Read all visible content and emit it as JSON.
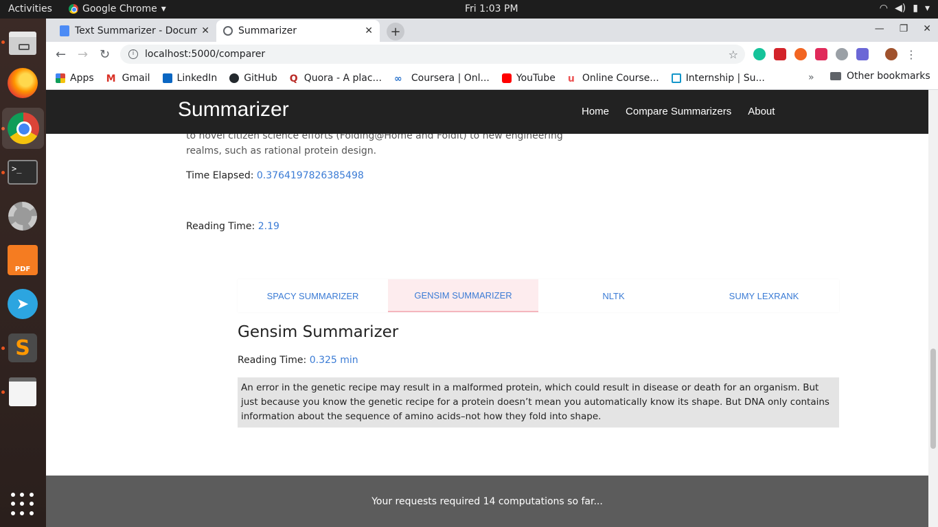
{
  "system": {
    "activities": "Activities",
    "app_name": "Google Chrome",
    "clock": "Fri  1:03 PM"
  },
  "dock": {
    "items": [
      "Files",
      "Firefox",
      "Chrome",
      "Terminal",
      "Settings",
      "PDF Editor",
      "Telegram",
      "Sublime Text",
      "Text Editor",
      "Show Applications"
    ]
  },
  "browser": {
    "tabs": [
      {
        "title": "Text Summarizer - Docum",
        "active": false
      },
      {
        "title": "Summarizer",
        "active": true
      }
    ],
    "url": "localhost:5000/comparer",
    "bookmarks": [
      "Apps",
      "Gmail",
      "LinkedIn",
      "GitHub",
      "Quora - A plac...",
      "Coursera | Onl...",
      "YouTube",
      "Online Course...",
      "Internship | Su..."
    ],
    "other_bookmarks": "Other bookmarks",
    "more": "»"
  },
  "site": {
    "brand": "Summarizer",
    "nav": [
      "Home",
      "Compare Summarizers",
      "About"
    ]
  },
  "content": {
    "cut_text": "to novel citizen science efforts (Folding@Home and Foldit) to new engineering realms, such as rational protein design.",
    "time_elapsed_label": "Time Elapsed:",
    "time_elapsed_value": "0.3764197826385498",
    "reading_time_label": "Reading Time:",
    "reading_time_value": "2.19",
    "summarizer_tabs": [
      "SPACY SUMMARIZER",
      "GENSIM SUMMARIZER",
      "NLTK",
      "SUMY LEXRANK"
    ],
    "selected_tab": "GENSIM SUMMARIZER",
    "section_title": "Gensim Summarizer",
    "section_reading_label": "Reading Time:",
    "section_reading_value": "0.325 min",
    "summary_text": "An error in the genetic recipe may result in a malformed protein, which could result in disease or death for an organism. But just because you know the genetic recipe for a protein doesn’t mean you automatically know its shape. But DNA only contains information about the sequence of amino acids–not how they fold into shape."
  },
  "footer": {
    "text": "Your requests required 14 computations so far..."
  }
}
